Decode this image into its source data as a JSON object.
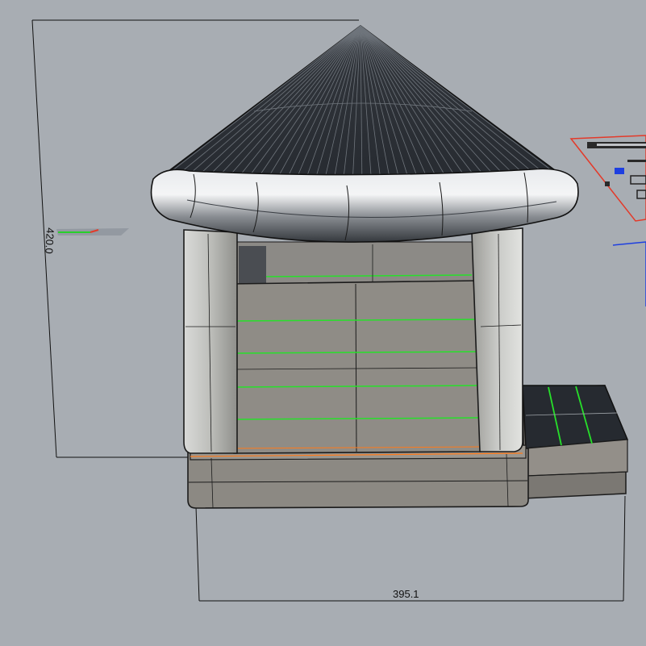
{
  "viewport": {
    "background": "#a8adb3"
  },
  "dimensions": {
    "height_label": "420.0",
    "width_label": "395.1"
  },
  "colors": {
    "roof_dark": "#2a2e34",
    "roof_line": "#6f757c",
    "gutter_light": "#e7e9ec",
    "gutter_dark": "#3a3e44",
    "wall": "#8f8c86",
    "wall_shade": "#7a7772",
    "column": "#b9bab8",
    "base": "#8c8983",
    "edge": "#1b1b1b",
    "green_seam": "#27e02a",
    "orange_seam": "#ff7a1a",
    "dim_line": "#111111",
    "red_frame": "#e33a2a",
    "blue_frame": "#1e3fe0"
  },
  "icons": {
    "axis_widget": "axis-gizmo-icon",
    "detail_sheet": "detail-sheet-icon"
  }
}
